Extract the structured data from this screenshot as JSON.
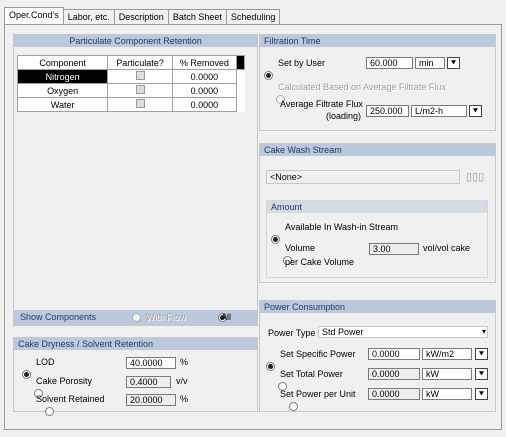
{
  "tabs": [
    {
      "label": "Oper.Cond's"
    },
    {
      "label": "Labor, etc."
    },
    {
      "label": "Description"
    },
    {
      "label": "Batch Sheet"
    },
    {
      "label": "Scheduling"
    }
  ],
  "particulate": {
    "title": "Particulate Component Retention",
    "columns": [
      "Component",
      "Particulate?",
      "% Removed"
    ],
    "rows": [
      {
        "component": "Nitrogen",
        "removed": "0.0000"
      },
      {
        "component": "Oxygen",
        "removed": "0.0000"
      },
      {
        "component": "Water",
        "removed": "0.0000"
      }
    ],
    "show_components": "Show Components",
    "with_flow": "With Flow",
    "all": "All"
  },
  "cake": {
    "title": "Cake Dryness / Solvent Retention",
    "lod_label": "LOD",
    "lod_value": "40.0000",
    "lod_unit": "%",
    "porosity_label": "Cake Porosity",
    "porosity_value": "0.4000",
    "porosity_unit": "v/v",
    "solvent_label": "Solvent Retained",
    "solvent_value": "20.0000",
    "solvent_unit": "%"
  },
  "filtration": {
    "title": "Filtration Time",
    "set_by_user": "Set by User",
    "time_value": "60.000",
    "time_unit": "min",
    "calculated": "Calculated Based on Average Filtrate Flux",
    "flux_label_1": "Average Filtrate Flux",
    "flux_label_2": "(loading)",
    "flux_value": "250.000",
    "flux_unit": "L/m2-h"
  },
  "cake_wash": {
    "title": "Cake Wash Stream",
    "stream": "<None>",
    "amount_title": "Amount",
    "available": "Available In Wash-in Stream",
    "volume_1": "Volume",
    "volume_2": "per Cake Volume",
    "volume_value": "3.00",
    "volume_unit": "vol/vol cake"
  },
  "power": {
    "title": "Power Consumption",
    "type_label": "Power Type",
    "type_value": "Std Power",
    "specific_label": "Set Specific Power",
    "specific_value": "0.0000",
    "specific_unit": "kW/m2",
    "total_label": "Set Total Power",
    "total_value": "0.0000",
    "total_unit": "kW",
    "per_unit_label": "Set Power per Unit",
    "per_unit_value": "0.0000",
    "per_unit_unit": "kW"
  }
}
